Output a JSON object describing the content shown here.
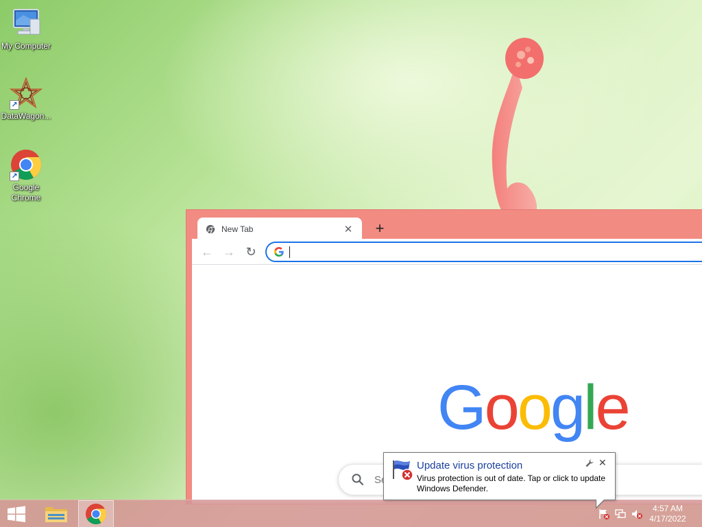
{
  "desktop": {
    "icons": [
      {
        "label": "My Computer",
        "icon": "computer-icon"
      },
      {
        "label": "DataWagon...",
        "icon": "datawagon-icon"
      },
      {
        "label": "Google Chrome",
        "icon": "chrome-icon"
      }
    ]
  },
  "browser": {
    "tab": {
      "title": "New Tab",
      "close": "✕"
    },
    "new_tab_label": "+",
    "nav": {
      "back": "←",
      "forward": "→",
      "reload": "↻"
    },
    "omnibox": {
      "value": "",
      "placeholder": ""
    },
    "logo": {
      "letters": [
        "G",
        "o",
        "o",
        "g",
        "l",
        "e"
      ],
      "colors": [
        "#4285f4",
        "#ea4335",
        "#fbbc05",
        "#4285f4",
        "#34a853",
        "#ea4335"
      ]
    },
    "search": {
      "placeholder": "Se"
    }
  },
  "notification": {
    "title": "Update virus protection",
    "body": "Virus protection is out of date. Tap or click to update Windows Defender.",
    "options_icon": "wrench-icon",
    "close": "✕"
  },
  "taskbar": {
    "apps": [
      {
        "name": "file-explorer",
        "icon": "folder-icon",
        "active": false
      },
      {
        "name": "google-chrome",
        "icon": "chrome-icon",
        "active": true
      }
    ],
    "tray": [
      "action-center-flag-icon",
      "network-icon",
      "volume-muted-icon"
    ],
    "clock": {
      "time": "4:57 AM",
      "date": "4/17/2022"
    }
  },
  "colors": {
    "chrome_frame": "#f28b82",
    "taskbar": "#d69696",
    "accent": "#1a73e8",
    "notification_title": "#1a3f9e"
  }
}
